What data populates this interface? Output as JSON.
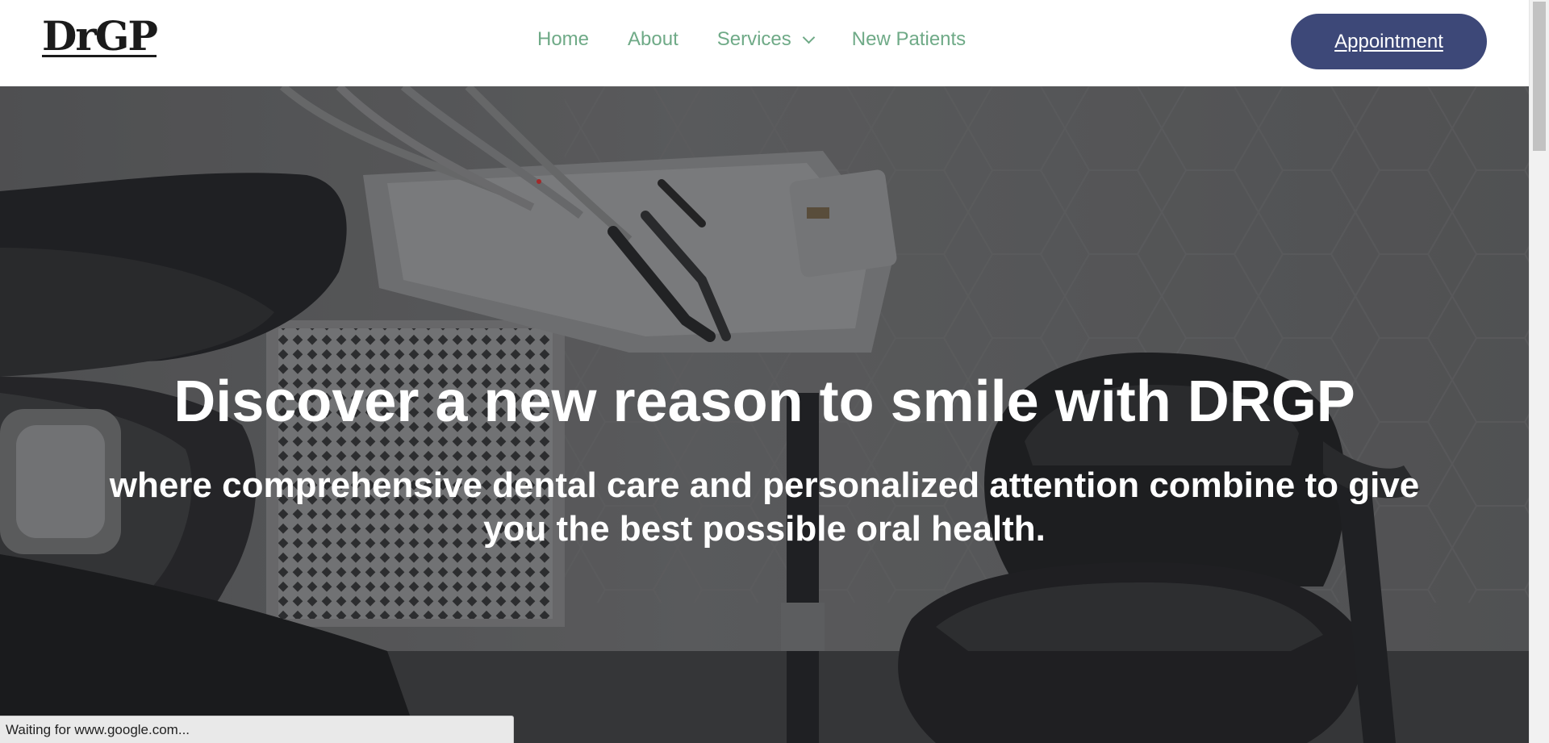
{
  "header": {
    "logo": "DrGP",
    "nav": [
      {
        "label": "Home"
      },
      {
        "label": "About"
      },
      {
        "label": "Services",
        "has_dropdown": true
      },
      {
        "label": "New Patients"
      }
    ],
    "cta_label": "Appointment"
  },
  "hero": {
    "title": "Discover a new reason to smile with DRGP",
    "subtitle": "where comprehensive dental care and personalized attention combine to give you the best possible oral health.",
    "background": "dental-clinic-chair-photo"
  },
  "status_bar": {
    "text": "Waiting for www.google.com..."
  },
  "colors": {
    "nav_text": "#6faa87",
    "cta_bg": "#3d4878",
    "logo": "#1b1b1b"
  }
}
